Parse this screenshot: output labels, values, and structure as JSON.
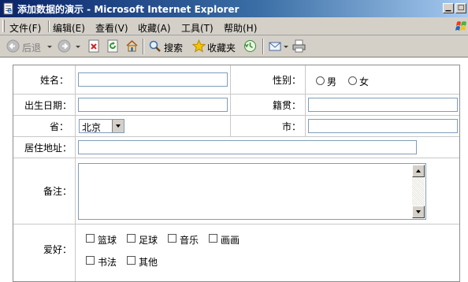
{
  "window": {
    "title": "添加数据的演示 - Microsoft Internet Explorer",
    "minimize_glyph": "▁",
    "maximize_glyph": "□"
  },
  "menu": [
    {
      "label": "文件(F)"
    },
    {
      "label": "编辑(E)"
    },
    {
      "label": "查看(V)"
    },
    {
      "label": "收藏(A)"
    },
    {
      "label": "工具(T)"
    },
    {
      "label": "帮助(H)"
    }
  ],
  "toolbar": {
    "back_label": "后退",
    "search_label": "搜索",
    "favorites_label": "收藏夹"
  },
  "form": {
    "name_label": "姓名：",
    "name_value": "",
    "gender_label": "性别：",
    "gender_options": [
      "男",
      "女"
    ],
    "birthdate_label": "出生日期：",
    "birthdate_value": "",
    "native_place_label": "籍贯：",
    "native_place_value": "",
    "province_label": "省：",
    "province_selected": "北京",
    "city_label": "市：",
    "city_value": "",
    "address_label": "居住地址：",
    "address_value": "",
    "remarks_label": "备注：",
    "remarks_value": "",
    "hobbies_label": "爱好：",
    "hobbies": [
      "篮球",
      "足球",
      "音乐",
      "画画",
      "书法",
      "其他"
    ]
  },
  "colors": {
    "titlebar_start": "#0a246a",
    "titlebar_end": "#a6caf0",
    "chrome": "#d4d0c8",
    "input_border": "#7f9db9"
  }
}
